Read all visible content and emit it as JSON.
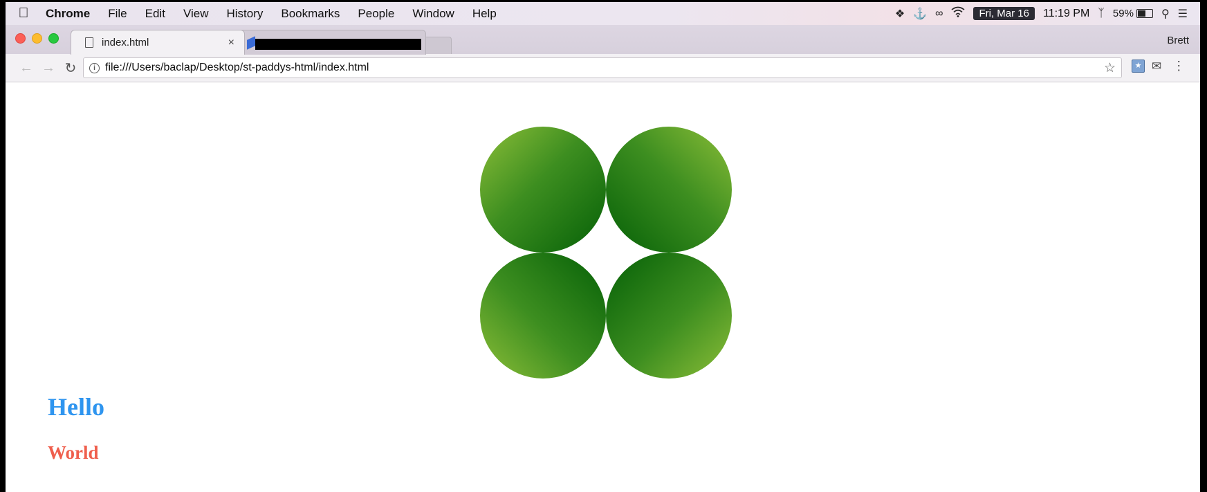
{
  "menubar": {
    "app_name": "Chrome",
    "items": [
      "File",
      "Edit",
      "View",
      "History",
      "Bookmarks",
      "People",
      "Window",
      "Help"
    ],
    "date": "Fri, Mar 16",
    "time": "11:19 PM",
    "battery": "59%",
    "battery_level": 0.59
  },
  "tabs": {
    "active_title": "index.html",
    "close_glyph": "×"
  },
  "profile": {
    "name": "Brett"
  },
  "toolbar": {
    "url": "file:///Users/baclap/Desktop/st-paddys-html/index.html"
  },
  "page": {
    "heading_hello": "Hello",
    "heading_world": "World",
    "colors": {
      "hello": "#2f95ef",
      "world": "#ef5e4c",
      "clover_dark": "#056007",
      "clover_light": "#8cbe38"
    }
  }
}
